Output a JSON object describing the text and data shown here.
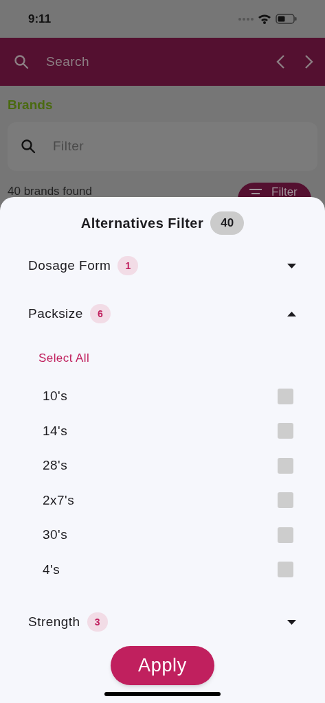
{
  "status_bar": {
    "time": "9:11"
  },
  "header": {
    "search_placeholder": "Search"
  },
  "page": {
    "title": "Brands",
    "filter_placeholder": "Filter",
    "result_count": "40 brands found",
    "filter_button": "Filter"
  },
  "sheet": {
    "title": "Alternatives Filter",
    "count": "40",
    "sections": [
      {
        "label": "Dosage Form",
        "count": "1",
        "expanded": false
      },
      {
        "label": "Packsize",
        "count": "6",
        "expanded": true,
        "select_all": "Select All",
        "options": [
          {
            "label": "10's",
            "checked": false
          },
          {
            "label": "14's",
            "checked": false
          },
          {
            "label": "28's",
            "checked": false
          },
          {
            "label": "2x7's",
            "checked": false
          },
          {
            "label": "30's",
            "checked": false
          },
          {
            "label": "4's",
            "checked": false
          }
        ]
      },
      {
        "label": "Strength",
        "count": "3",
        "expanded": false
      }
    ],
    "apply_button": "Apply"
  }
}
